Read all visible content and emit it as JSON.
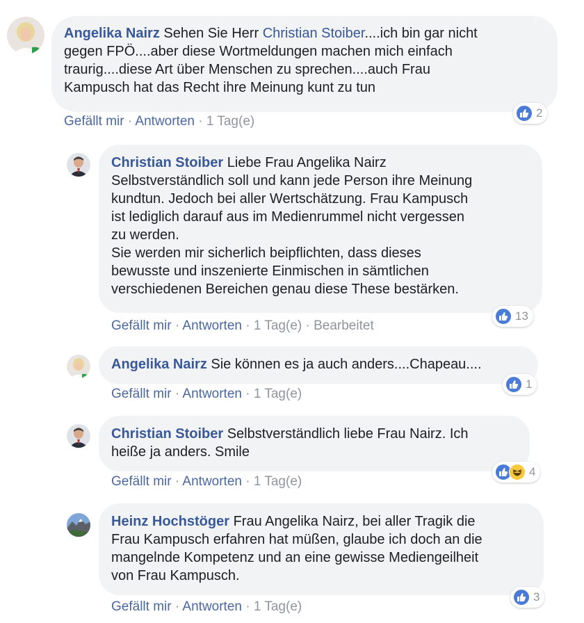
{
  "comments": [
    {
      "author": "Angelika Nairz",
      "line1_rest": " Sehen Sie Herr ",
      "mention": "Christian Stoiber",
      "line1_tail": "....ich bin gar nicht",
      "lines": [
        "gegen FPÖ....aber diese Wortmeldungen machen mich einfach",
        "traurig....diese Art über Menschen zu sprechen....auch Frau",
        "Kampusch hat das Recht ihre Meinung kunt zu tun"
      ],
      "like": "Gefällt mir",
      "reply": "Antworten",
      "time": "1 Tag(e)",
      "reactions": "2"
    },
    {
      "author": "Christian Stoiber",
      "line1_rest": " Liebe Frau Angelika Nairz",
      "lines": [
        "Selbstverständlich soll und kann jede Person ihre Meinung",
        "kundtun. Jedoch bei aller Wertschätzung. Frau Kampusch",
        "ist lediglich darauf aus im Medienrummel nicht vergessen",
        "zu werden.",
        "Sie werden mir sicherlich beipflichten, dass dieses",
        "bewusste und inszenierte Einmischen in sämtlichen",
        "verschiedenen Bereichen genau diese These bestärken."
      ],
      "like": "Gefällt mir",
      "reply": "Antworten",
      "time": "1 Tag(e)",
      "edited": "Bearbeitet",
      "reactions": "13"
    },
    {
      "author": "Angelika Nairz",
      "line1_rest": " Sie können es ja auch anders....Chapeau....",
      "like": "Gefällt mir",
      "reply": "Antworten",
      "time": "1 Tag(e)",
      "reactions": "1"
    },
    {
      "author": "Christian Stoiber",
      "line1_rest": " Selbstverständlich liebe Frau Nairz. Ich",
      "lines": [
        "heiße ja anders. Smile"
      ],
      "like": "Gefällt mir",
      "reply": "Antworten",
      "time": "1 Tag(e)",
      "reactions": "4"
    },
    {
      "author": "Heinz Hochstöger",
      "line1_rest": " Frau Angelika Nairz, bei aller Tragik die",
      "lines": [
        "Frau Kampusch erfahren hat müßen, glaube ich doch an die",
        "mangelnde Kompetenz und an eine gewisse Mediengeilheit",
        "von Frau Kampusch."
      ],
      "like": "Gefällt mir",
      "reply": "Antworten",
      "time": "1 Tag(e)",
      "reactions": "3"
    }
  ],
  "separator": " · ",
  "colors": {
    "link": "#385898",
    "bubble": "#f2f3f5",
    "like": "#4a7bd6",
    "meta": "#90949c"
  },
  "icons": {
    "like": "thumbs-up-icon",
    "haha": "laughing-face-icon"
  }
}
